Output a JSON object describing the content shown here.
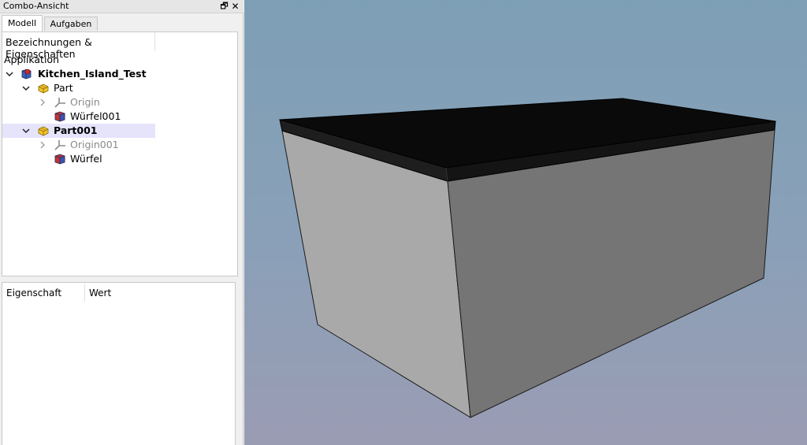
{
  "combo": {
    "title": "Combo-Ansicht",
    "float_glyph": "🗗",
    "close_glyph": "✕",
    "tabs": [
      {
        "label": "Modell",
        "active": true
      },
      {
        "label": "Aufgaben",
        "active": false
      }
    ]
  },
  "tree": {
    "header": "Bezeichnungen & Eigenschaften",
    "section": "Applikation",
    "items": [
      {
        "label": "Kitchen_Island_Test",
        "icon": "document-icon",
        "expanded": true
      },
      {
        "label": "Part",
        "icon": "part-icon",
        "expanded": true
      },
      {
        "label": "Origin",
        "icon": "origin-icon",
        "expanded": false
      },
      {
        "label": "Würfel001",
        "icon": "cube-icon"
      },
      {
        "label": "Part001",
        "icon": "part-icon",
        "expanded": true,
        "selected": true
      },
      {
        "label": "Origin001",
        "icon": "origin-icon",
        "expanded": false
      },
      {
        "label": "Würfel",
        "icon": "cube-icon"
      }
    ]
  },
  "properties": {
    "col_property": "Eigenschaft",
    "col_value": "Wert"
  },
  "colors": {
    "selection": "#e5e4fb",
    "top_face": "#0a0a0a",
    "left_face": "#a9a9a9",
    "right_face": "#757575"
  }
}
